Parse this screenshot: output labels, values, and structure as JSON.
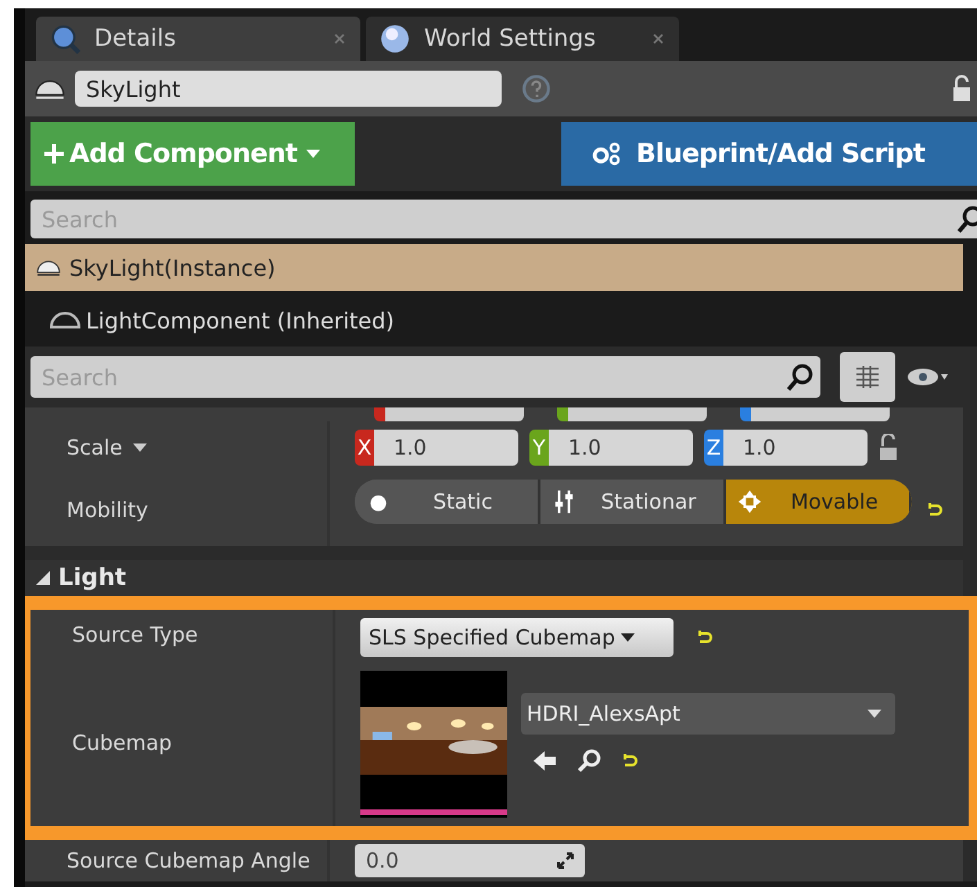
{
  "tabs": [
    {
      "label": "Details",
      "selected": true
    },
    {
      "label": "World Settings",
      "selected": false
    }
  ],
  "actor_name": "SkyLight",
  "buttons": [
    {
      "label": "Add Component",
      "kind": "add"
    },
    {
      "label": "Blueprint/Add Script",
      "kind": "blueprint"
    }
  ],
  "component_search": {
    "placeholder": "Search"
  },
  "components": [
    {
      "label": "SkyLight(Instance)",
      "selected": true,
      "children": [
        {
          "label": "LightComponent (Inherited)",
          "selected": false
        }
      ]
    }
  ],
  "details_search": {
    "placeholder": "Search"
  },
  "scale": {
    "label": "Scale",
    "axes": [
      {
        "axis": "X",
        "value": "1.0",
        "color": "#c8281e"
      },
      {
        "axis": "Y",
        "value": "1.0",
        "color": "#6aa51c"
      },
      {
        "axis": "Z",
        "value": "1.0",
        "color": "#2a7fe0"
      }
    ]
  },
  "mobility": {
    "label": "Mobility",
    "options": [
      {
        "label": "Static",
        "selected": false
      },
      {
        "label": "Stationar",
        "selected": false
      },
      {
        "label": "Movable",
        "selected": true
      }
    ]
  },
  "light_section": {
    "title": "Light",
    "expanded": true,
    "properties": [
      {
        "kind": "combo",
        "label": "Source Type",
        "value": "SLS Specified Cubemap"
      },
      {
        "kind": "asset",
        "label": "Cubemap",
        "value": "HDRI_AlexsApt"
      },
      {
        "kind": "number",
        "label": "Source Cubemap Angle",
        "value": "0.0"
      }
    ]
  }
}
